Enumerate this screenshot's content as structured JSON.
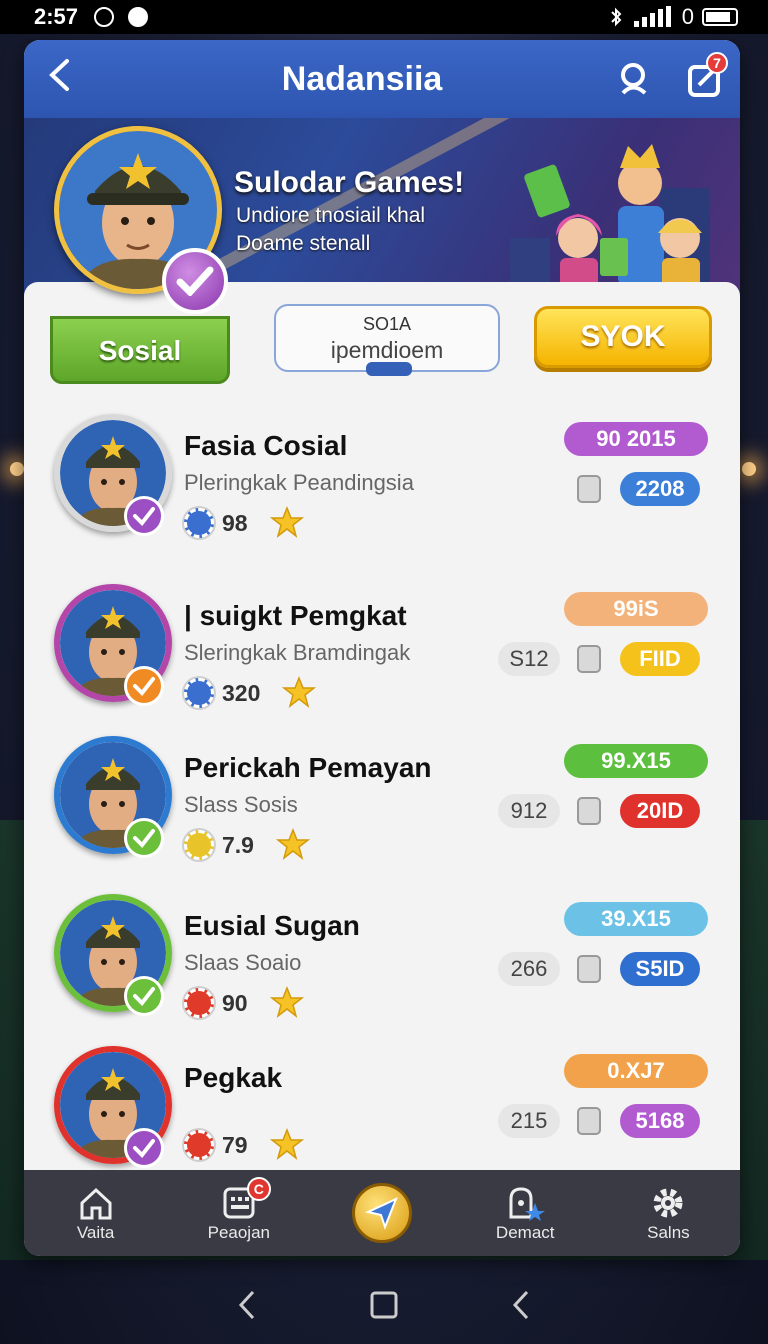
{
  "status_bar": {
    "time": "2:57",
    "right_text": "0"
  },
  "header": {
    "title": "Nadansiia",
    "notification_count": "7"
  },
  "banner": {
    "headline": "Sulodar Games!",
    "line1": "Undiore tnosiail khal",
    "line2": "Doame stenall"
  },
  "profile": {
    "tag_label": "Sosial"
  },
  "center_box": {
    "line1": "SO1A",
    "line2": "ipemdioem"
  },
  "action_button": {
    "label": "SYOK"
  },
  "players": [
    {
      "name": "Fasia Cosial",
      "subtitle": "Pleringkak Peandingsia",
      "score": "98",
      "pill_top": "90  2015",
      "pill_top_color": "#b25bd1",
      "pill_mid": "2208",
      "pill_mid_color": "#3b7fd8",
      "ring_color": "#d9d9d9",
      "check_color": "#9b4fc2",
      "chip_color": "#3a6fd0"
    },
    {
      "name": "| suigkt Pemgkat",
      "subtitle": "Sleringkak Bramdingak",
      "score": "320",
      "left_value": "S12",
      "pill_top": "99iS",
      "pill_top_color": "#f2b27a",
      "pill_mid": "FIID",
      "pill_mid_color": "#f4c21a",
      "ring_color": "#b346a8",
      "check_color": "#f08a22",
      "chip_color": "#3a6fd0"
    },
    {
      "name": "Perickah Pemayan",
      "subtitle": "Slass Sosis",
      "score": "7.9",
      "left_value": "912",
      "pill_top": "99.X15",
      "pill_top_color": "#5cbf3e",
      "pill_mid": "20ID",
      "pill_mid_color": "#e0322c",
      "ring_color": "#2c7bd0",
      "check_color": "#6cbf3a",
      "chip_color": "#e8c42a"
    },
    {
      "name": "Eusial Sugan",
      "subtitle": "Slaas Soaio",
      "score": "90",
      "left_value": "266",
      "pill_top": "39.X15",
      "pill_top_color": "#6cc2e6",
      "pill_mid": "S5ID",
      "pill_mid_color": "#2f6fd0",
      "ring_color": "#6cbf3a",
      "check_color": "#6cbf3a",
      "chip_color": "#e03a2a"
    },
    {
      "name": "Pegkak",
      "subtitle": "",
      "score": "79",
      "left_value": "215",
      "pill_top": "0.XJ7",
      "pill_top_color": "#f2a24a",
      "pill_mid": "5168",
      "pill_mid_color": "#b25bd1",
      "ring_color": "#e0322c",
      "check_color": "#9b4fc2",
      "chip_color": "#e03a2a"
    }
  ],
  "bottom_nav": {
    "items": [
      {
        "label": "Vaita",
        "icon": "home-icon"
      },
      {
        "label": "Peaojan",
        "icon": "calendar-icon",
        "badge": "C"
      },
      {
        "label": "",
        "icon": "send-icon"
      },
      {
        "label": "Demact",
        "icon": "profile-icon"
      },
      {
        "label": "Salns",
        "icon": "gear-icon"
      }
    ]
  }
}
